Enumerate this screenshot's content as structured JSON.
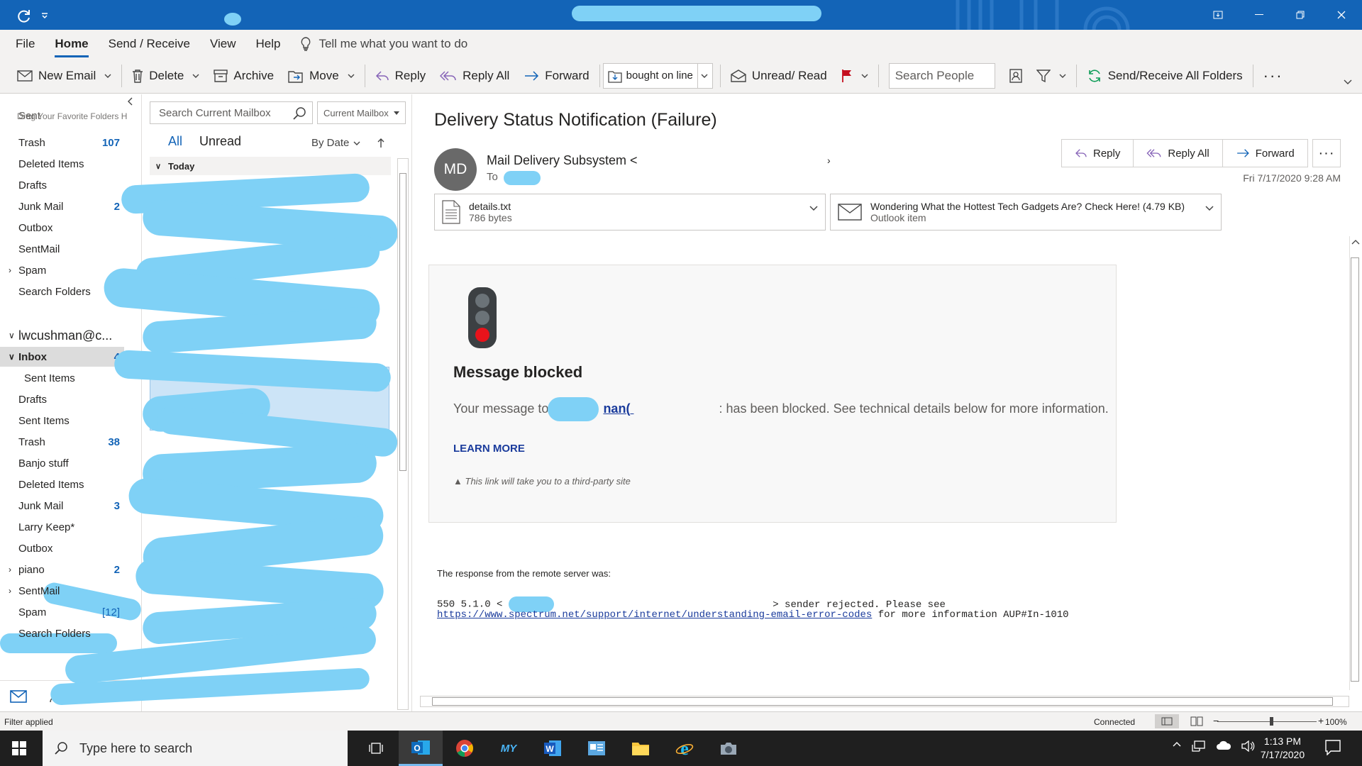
{
  "menu": {
    "items": [
      "File",
      "Home",
      "Send / Receive",
      "View",
      "Help"
    ],
    "tell_me": "Tell me what you want to do"
  },
  "ribbon": {
    "new_email": "New Email",
    "delete": "Delete",
    "archive": "Archive",
    "move": "Move",
    "reply": "Reply",
    "reply_all": "Reply All",
    "forward": "Forward",
    "quick_step": "bought on line",
    "unread_read": "Unread/ Read",
    "search_people": "Search People",
    "send_receive_all": "Send/Receive All Folders"
  },
  "folders": {
    "fav_hint": "Drag Your Favorite Folders H",
    "top_items": [
      {
        "label": "Sent",
        "count": ""
      },
      {
        "label": "Trash",
        "count": "107"
      },
      {
        "label": "Deleted Items",
        "count": ""
      },
      {
        "label": "Drafts",
        "count": ""
      },
      {
        "label": "Junk Mail",
        "count": "2"
      },
      {
        "label": "Outbox",
        "count": ""
      },
      {
        "label": "SentMail",
        "count": ""
      },
      {
        "label": "Spam",
        "count": ""
      },
      {
        "label": "Search Folders",
        "count": ""
      }
    ],
    "account": "lwcushman@c...",
    "account_items": [
      {
        "label": "Inbox",
        "count": "4"
      },
      {
        "label": "Sent Items",
        "count": ""
      },
      {
        "label": "Drafts",
        "count": ""
      },
      {
        "label": "Sent Items",
        "count": ""
      },
      {
        "label": "Trash",
        "count": "38"
      },
      {
        "label": "Banjo stuff",
        "count": ""
      },
      {
        "label": "Deleted Items",
        "count": ""
      },
      {
        "label": "Junk Mail",
        "count": "3"
      },
      {
        "label": "Larry Keep*",
        "count": ""
      },
      {
        "label": "Outbox",
        "count": ""
      },
      {
        "label": "piano",
        "count": "2"
      },
      {
        "label": "SentMail",
        "count": ""
      },
      {
        "label": "Spam",
        "count": "[12]"
      },
      {
        "label": "Search Folders",
        "count": ""
      }
    ]
  },
  "list": {
    "search_placeholder": "Search Current Mailbox",
    "scope": "Current Mailbox",
    "filter_all": "All",
    "filter_unread": "Unread",
    "sort": "By Date",
    "group_today": "Today"
  },
  "reading": {
    "subject": "Delivery Status Notification (Failure)",
    "avatar": "MD",
    "sender": "Mail Delivery Subsystem <",
    "to_label": "To",
    "date": "Fri 7/17/2020 9:28 AM",
    "actions": {
      "reply": "Reply",
      "reply_all": "Reply All",
      "forward": "Forward"
    },
    "attachments": [
      {
        "name": "details.txt",
        "size": "786 bytes"
      },
      {
        "name": "Wondering What the Hottest Tech Gadgets Are? Check Here! (4.79 KB)",
        "size": "Outlook item"
      }
    ],
    "card": {
      "title": "Message blocked",
      "text_before": "Your message to",
      "link_fragment": "nan(",
      "text_after": ": has been blocked. See technical details below for more information.",
      "learn_more": "LEARN MORE",
      "note": "This link will take you to a third-party site"
    },
    "response_label": "The response from the remote server was:",
    "response_code": "550 5.1.0 <",
    "response_tail": "> sender rejected. Please see",
    "response_url": "https://www.spectrum.net/support/internet/understanding-email-error-codes",
    "response_end": "for more information AUP#In-1010"
  },
  "status": {
    "filter": "Filter applied",
    "connection": "Connected",
    "zoom": "100%"
  },
  "taskbar": {
    "search": "Type here to search",
    "time": "1:13 PM",
    "date": "7/17/2020"
  },
  "colors": {
    "accent": "#1364b7",
    "scribble": "#7fd1f6",
    "link": "#1a3b9c"
  }
}
